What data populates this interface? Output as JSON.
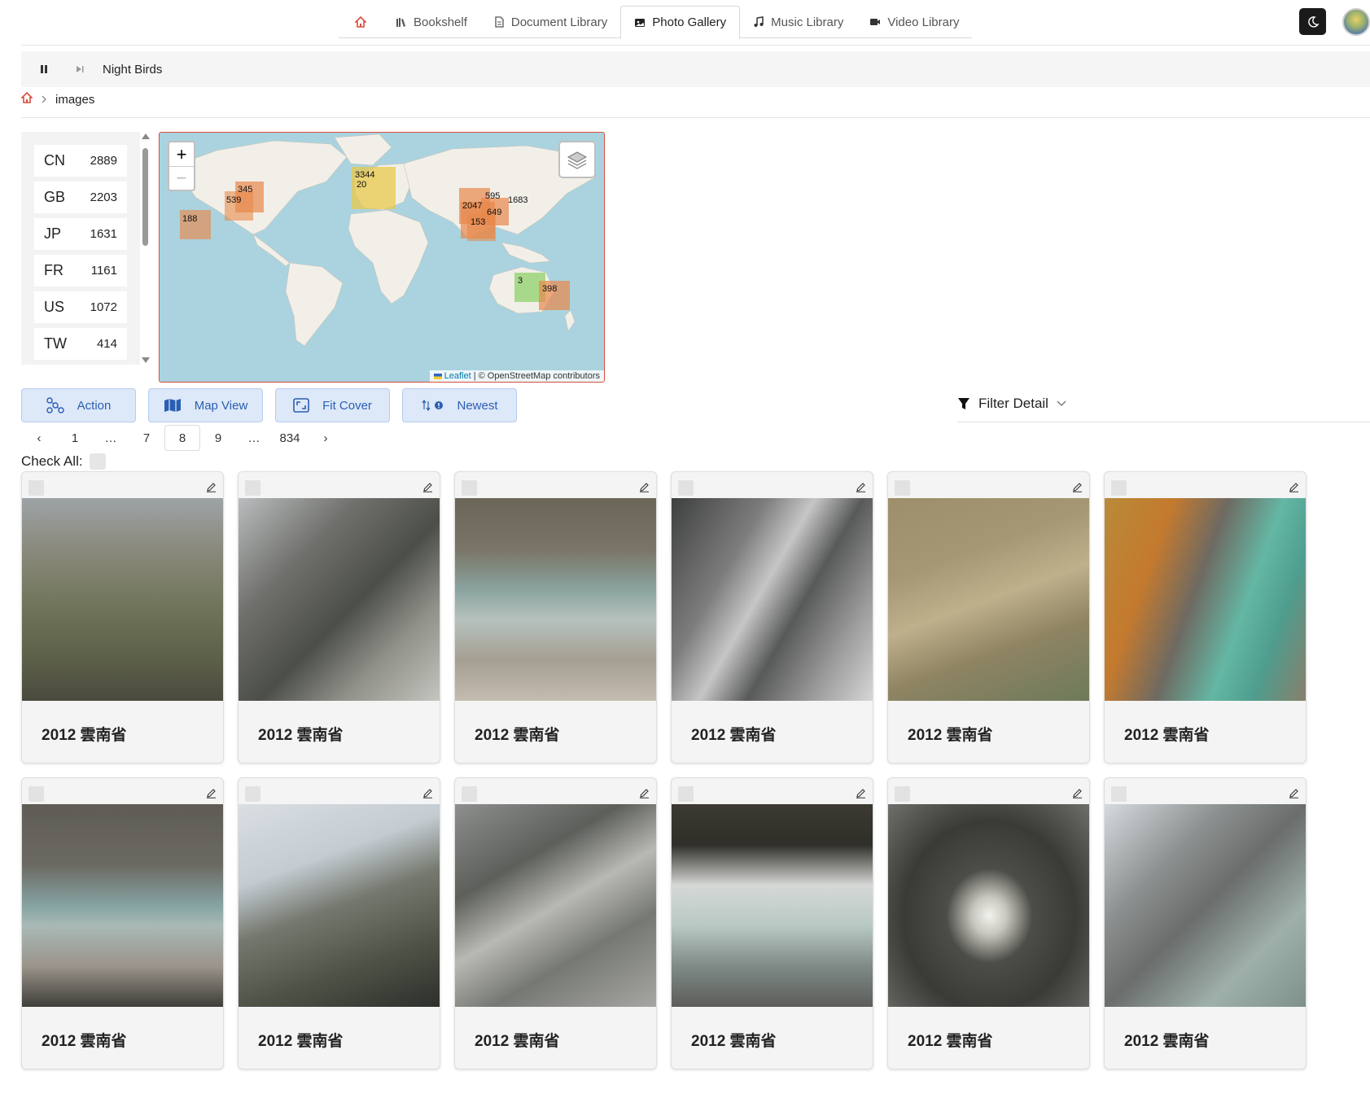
{
  "nav": {
    "tabs": [
      {
        "label": "Bookshelf",
        "icon": "books-icon"
      },
      {
        "label": "Document Library",
        "icon": "document-icon"
      },
      {
        "label": "Photo Gallery",
        "icon": "photo-icon",
        "active": true
      },
      {
        "label": "Music Library",
        "icon": "music-note-icon"
      },
      {
        "label": "Video Library",
        "icon": "video-camera-icon"
      }
    ]
  },
  "player": {
    "title": "Night Birds"
  },
  "breadcrumb": {
    "current": "images"
  },
  "countries": [
    {
      "code": "CN",
      "count": "2889"
    },
    {
      "code": "GB",
      "count": "2203"
    },
    {
      "code": "JP",
      "count": "1631"
    },
    {
      "code": "FR",
      "count": "1161"
    },
    {
      "code": "US",
      "count": "1072"
    },
    {
      "code": "TW",
      "count": "414"
    }
  ],
  "map": {
    "attribution_link": "Leaflet",
    "attribution_text": " | © OpenStreetMap contributors",
    "zoom_in": "+",
    "zoom_out": "−",
    "clusters": [
      "345",
      "539",
      "188",
      "3344",
      "20",
      "595",
      "1683",
      "2047",
      "649",
      "153",
      "3",
      "398"
    ]
  },
  "actions": {
    "action": "Action",
    "map_view": "Map View",
    "fit_cover": "Fit Cover",
    "newest": "Newest",
    "filter_detail": "Filter Detail"
  },
  "pagination": {
    "prev": "‹",
    "next": "›",
    "pages": [
      "1",
      "…",
      "7",
      "8",
      "9",
      "…",
      "834"
    ],
    "current": "8"
  },
  "check_all": {
    "label": "Check All:"
  },
  "photos": [
    {
      "title": "2012 雲南省"
    },
    {
      "title": "2012 雲南省"
    },
    {
      "title": "2012 雲南省"
    },
    {
      "title": "2012 雲南省"
    },
    {
      "title": "2012 雲南省"
    },
    {
      "title": "2012 雲南省"
    },
    {
      "title": "2012 雲南省"
    },
    {
      "title": "2012 雲南省"
    },
    {
      "title": "2012 雲南省"
    },
    {
      "title": "2012 雲南省"
    },
    {
      "title": "2012 雲南省"
    },
    {
      "title": "2012 雲南省"
    }
  ],
  "colors": {
    "accent": "#2b5fb3",
    "button_bg": "#dde8f8",
    "map_border": "#d94e3d",
    "cluster_orange": "#e8884a",
    "cluster_yellow": "#e8c84a",
    "cluster_green": "#8fd16a"
  }
}
